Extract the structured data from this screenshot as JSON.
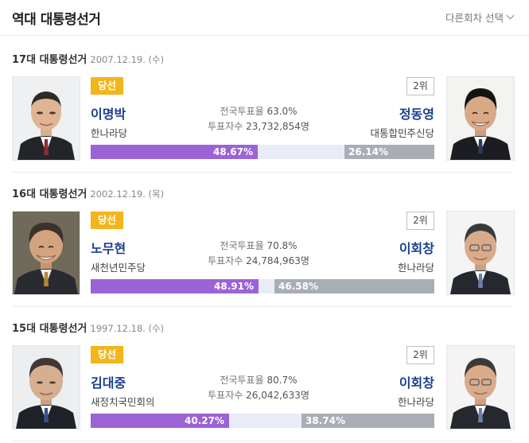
{
  "header": {
    "title": "역대 대통령선거",
    "select_label": "다른회차 선택"
  },
  "elections": [
    {
      "title": "17대 대통령선거",
      "date": "2007.12.19. (수)",
      "winner": {
        "badge": "당선",
        "name": "이명박",
        "party": "한나라당",
        "share": 48.67,
        "share_label": "48.67%"
      },
      "runner": {
        "badge": "2위",
        "name": "정동영",
        "party": "대통합민주신당",
        "share": 26.14,
        "share_label": "26.14%"
      },
      "turnout": {
        "label": "전국투표율",
        "value": "63.0%"
      },
      "votes": {
        "label": "투표자수",
        "value": "23,732,854명"
      }
    },
    {
      "title": "16대 대통령선거",
      "date": "2002.12.19. (목)",
      "winner": {
        "badge": "당선",
        "name": "노무현",
        "party": "새천년민주당",
        "share": 48.91,
        "share_label": "48.91%"
      },
      "runner": {
        "badge": "2위",
        "name": "이회창",
        "party": "한나라당",
        "share": 46.58,
        "share_label": "46.58%"
      },
      "turnout": {
        "label": "전국투표율",
        "value": "70.8%"
      },
      "votes": {
        "label": "투표자수",
        "value": "24,784,963명"
      }
    },
    {
      "title": "15대 대통령선거",
      "date": "1997.12.18. (수)",
      "winner": {
        "badge": "당선",
        "name": "김대중",
        "party": "새정치국민회의",
        "share": 40.27,
        "share_label": "40.27%"
      },
      "runner": {
        "badge": "2위",
        "name": "이회창",
        "party": "한나라당",
        "share": 38.74,
        "share_label": "38.74%"
      },
      "turnout": {
        "label": "전국투표율",
        "value": "80.7%"
      },
      "votes": {
        "label": "투표자수",
        "value": "26,042,633명"
      }
    }
  ],
  "colors": {
    "winner_bar": "#9b63d6",
    "runner_bar": "#a9adb5",
    "badge": "#f2b51c",
    "name": "#1a3f8f"
  }
}
